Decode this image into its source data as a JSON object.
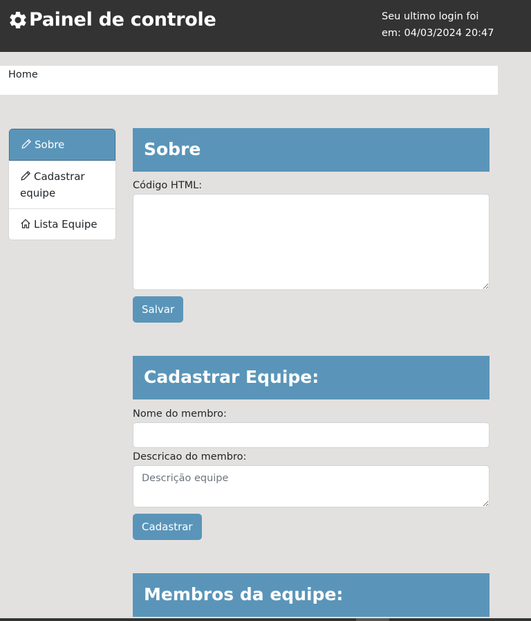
{
  "header": {
    "title": "Painel de controle",
    "icon": "gear-icon",
    "last_login_line1": "Seu ultimo login foi",
    "last_login_line2": "em: 04/03/2024 20:47"
  },
  "breadcrumb": {
    "home": "Home"
  },
  "sidebar": {
    "items": [
      {
        "label": "Sobre",
        "icon": "pencil-icon",
        "active": true
      },
      {
        "label": "Cadastrar equipe",
        "icon": "pencil-icon",
        "active": false
      },
      {
        "label": "Lista Equipe",
        "icon": "house-icon",
        "active": false
      }
    ]
  },
  "sobre": {
    "title": "Sobre",
    "html_label": "Código HTML:",
    "html_value": "",
    "save_label": "Salvar"
  },
  "cadastrar": {
    "title": "Cadastrar Equipe:",
    "name_label": "Nome do membro:",
    "name_value": "",
    "desc_label": "Descricao do membro:",
    "desc_placeholder": "Descrição equipe",
    "submit_label": "Cadastrar"
  },
  "membros": {
    "title": "Membros da equipe:"
  },
  "colors": {
    "topbar": "#333333",
    "accent": "#5a95b9",
    "background": "#e3e1df"
  }
}
